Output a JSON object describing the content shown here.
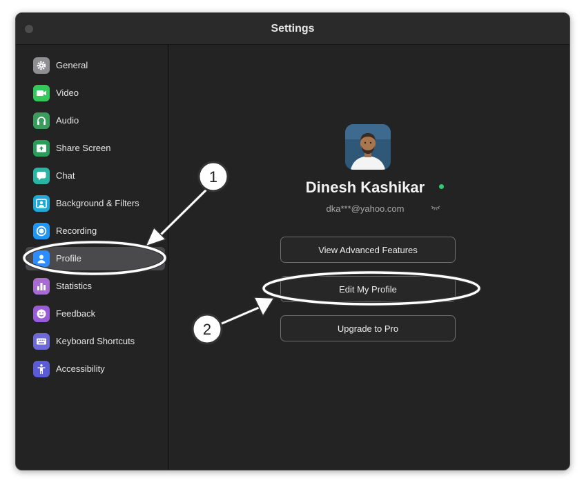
{
  "window": {
    "title": "Settings"
  },
  "sidebar": {
    "items": [
      {
        "label": "General",
        "icon": "gear-icon",
        "color": "#8e8e93",
        "active": false
      },
      {
        "label": "Video",
        "icon": "video-camera-icon",
        "color": "#34c759",
        "active": false
      },
      {
        "label": "Audio",
        "icon": "headphones-icon",
        "color": "#3a9d5d",
        "active": false
      },
      {
        "label": "Share Screen",
        "icon": "share-screen-icon",
        "color": "#2a9d5a",
        "active": false
      },
      {
        "label": "Chat",
        "icon": "chat-bubble-icon",
        "color": "#2bb3a4",
        "active": false
      },
      {
        "label": "Background & Filters",
        "icon": "background-person-icon",
        "color": "#1fa9d8",
        "active": false
      },
      {
        "label": "Recording",
        "icon": "record-icon",
        "color": "#2196f3",
        "active": false
      },
      {
        "label": "Profile",
        "icon": "profile-person-icon",
        "color": "#2d8cff",
        "active": true
      },
      {
        "label": "Statistics",
        "icon": "bar-chart-icon",
        "color": "#a86bd1",
        "active": false
      },
      {
        "label": "Feedback",
        "icon": "smiley-icon",
        "color": "#9a5bd6",
        "active": false
      },
      {
        "label": "Keyboard Shortcuts",
        "icon": "keyboard-icon",
        "color": "#6d6ad8",
        "active": false
      },
      {
        "label": "Accessibility",
        "icon": "accessibility-icon",
        "color": "#5b5bd6",
        "active": false
      }
    ]
  },
  "profile": {
    "name": "Dinesh Kashikar",
    "email": "dka***@yahoo.com",
    "status_color": "#2ecc71",
    "buttons": {
      "advanced": "View Advanced Features",
      "edit": "Edit My Profile",
      "upgrade": "Upgrade to Pro"
    }
  },
  "annotations": {
    "step1": "1",
    "step2": "2"
  }
}
